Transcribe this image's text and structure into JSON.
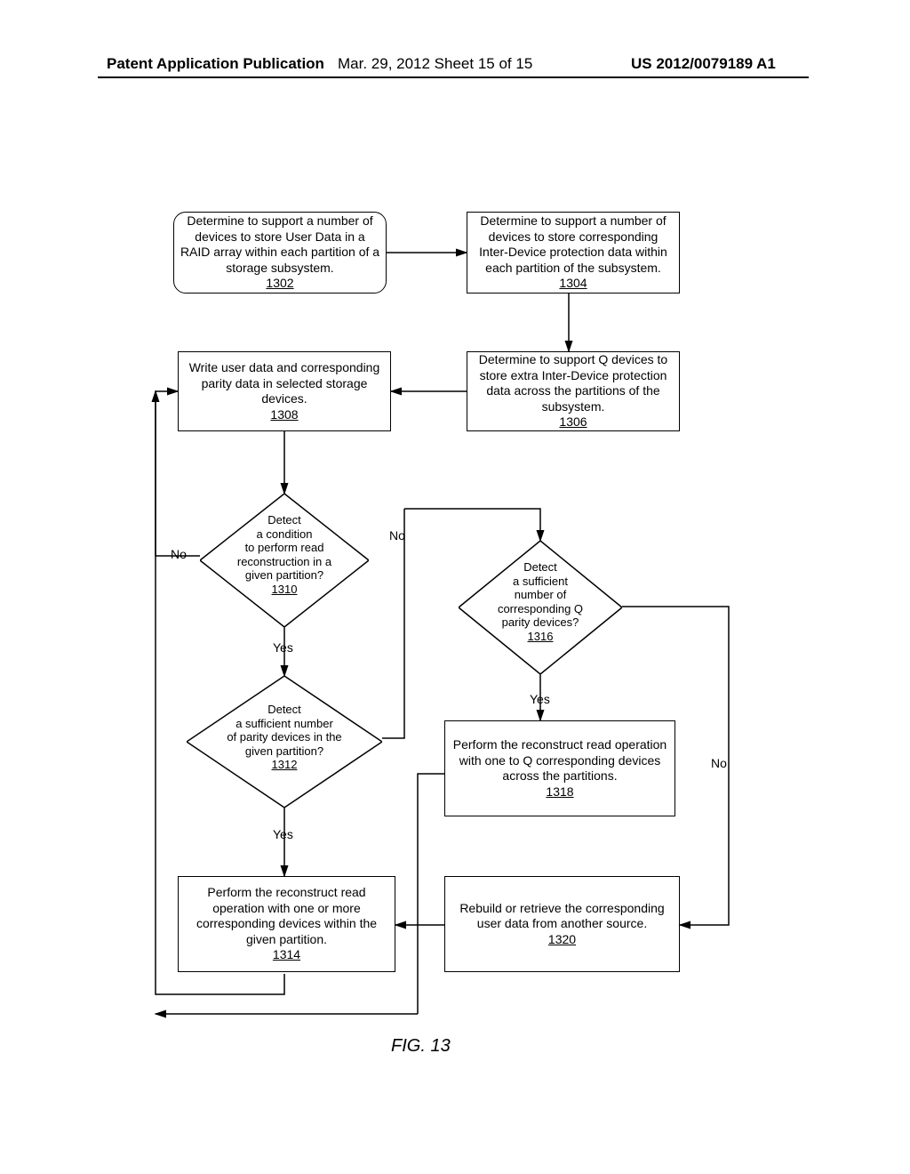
{
  "header": {
    "left": "Patent Application Publication",
    "mid": "Mar. 29, 2012   Sheet 15 of 15",
    "right": "US 2012/0079189 A1"
  },
  "boxes": {
    "b1302": {
      "text": "Determine to support a number of devices to store User Data in a RAID array within each partition of a storage subsystem.",
      "num": "1302"
    },
    "b1304": {
      "text": "Determine to support a number of devices to store corresponding Inter-Device protection data within each partition of the subsystem.",
      "num": "1304"
    },
    "b1306": {
      "text": "Determine to support Q devices to store extra Inter-Device protection data across the partitions of the subsystem.",
      "num": "1306"
    },
    "b1308": {
      "text": "Write user data and corresponding parity data in selected storage devices.",
      "num": "1308"
    },
    "b1314": {
      "text": "Perform the reconstruct read operation with one or more corresponding devices  within the given partition.",
      "num": "1314"
    },
    "b1318": {
      "text": "Perform the reconstruct read operation with one to Q corresponding devices across the partitions.",
      "num": "1318"
    },
    "b1320": {
      "text": "Rebuild or retrieve the corresponding user data from another source.",
      "num": "1320"
    }
  },
  "diamonds": {
    "d1310": {
      "line1": "Detect",
      "line2": "a condition",
      "line3": "to perform read",
      "line4": "reconstruction in a",
      "line5": "given partition?",
      "num": "1310"
    },
    "d1312": {
      "line1": "Detect",
      "line2": "a sufficient number",
      "line3": "of parity devices in the",
      "line4": "given partition?",
      "num": "1312"
    },
    "d1316": {
      "line1": "Detect",
      "line2": "a sufficient",
      "line3": "number of",
      "line4": "corresponding Q",
      "line5": "parity devices?",
      "num": "1316"
    }
  },
  "labels": {
    "no1": "No",
    "no2": "No",
    "no3": "No",
    "yes1": "Yes",
    "yes2": "Yes",
    "yes3": "Yes"
  },
  "figcaption": "FIG. 13"
}
